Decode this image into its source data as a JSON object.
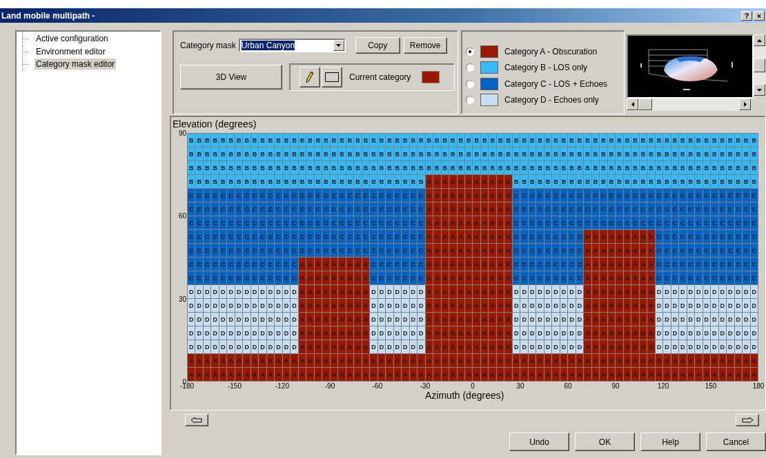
{
  "window": {
    "title": "Land mobile multipath -",
    "help_button": "?",
    "close_button": "×"
  },
  "tree": {
    "items": [
      {
        "label": "Active configuration",
        "selected": false
      },
      {
        "label": "Environment editor",
        "selected": false
      },
      {
        "label": "Category mask editor",
        "selected": true
      }
    ]
  },
  "mask": {
    "label": "Category mask",
    "value": "Urban Canyon",
    "buttons": [
      "Copy",
      "Remove"
    ]
  },
  "view_button": "3D View",
  "current_category": {
    "label": "Current category"
  },
  "categories": [
    {
      "label": "Category A - Obscuration",
      "color": "#9a1800",
      "selected": true
    },
    {
      "label": "Category B - LOS only",
      "color": "#33bbff",
      "selected": false
    },
    {
      "label": "Category C - LOS + Echoes",
      "color": "#0064c4",
      "selected": false
    },
    {
      "label": "Category D - Echoes only",
      "color": "#c6def2",
      "selected": false
    }
  ],
  "grid": {
    "title": "Elevation (degrees)",
    "xlabel": "Azimuth (degrees)",
    "y_ticks": [
      "90",
      "60",
      "30",
      "0"
    ],
    "x_ticks": [
      "-180",
      "-150",
      "-120",
      "-90",
      "-60",
      "-30",
      "0",
      "30",
      "60",
      "90",
      "120",
      "150",
      "180"
    ],
    "rows": [
      [
        "B",
        "B",
        "B",
        "B",
        "B",
        "B",
        "B",
        "B",
        "B",
        "B",
        "B",
        "B",
        "B",
        "B",
        "B",
        "B",
        "B",
        "B",
        "B",
        "B",
        "B",
        "B",
        "B",
        "B",
        "B",
        "B",
        "B",
        "B",
        "B",
        "B",
        "B",
        "B",
        "B",
        "B",
        "B",
        "B",
        "B",
        "B",
        "B",
        "B",
        "B",
        "B",
        "B",
        "B",
        "B",
        "B",
        "B",
        "B",
        "B",
        "B",
        "B",
        "B",
        "B",
        "B",
        "B",
        "B",
        "B",
        "B",
        "B",
        "B",
        "B",
        "B",
        "B",
        "B",
        "B",
        "B",
        "B",
        "B",
        "B",
        "B",
        "B",
        "B"
      ],
      [
        "B",
        "B",
        "B",
        "B",
        "B",
        "B",
        "B",
        "B",
        "B",
        "B",
        "B",
        "B",
        "B",
        "B",
        "B",
        "B",
        "B",
        "B",
        "B",
        "B",
        "B",
        "B",
        "B",
        "B",
        "B",
        "B",
        "B",
        "B",
        "B",
        "B",
        "B",
        "B",
        "B",
        "B",
        "B",
        "B",
        "B",
        "B",
        "B",
        "B",
        "B",
        "B",
        "B",
        "B",
        "B",
        "B",
        "B",
        "B",
        "B",
        "B",
        "B",
        "B",
        "B",
        "B",
        "B",
        "B",
        "B",
        "B",
        "B",
        "B",
        "B",
        "B",
        "B",
        "B",
        "B",
        "B",
        "B",
        "B",
        "B",
        "B",
        "B",
        "B"
      ],
      [
        "B",
        "B",
        "B",
        "B",
        "B",
        "B",
        "B",
        "B",
        "B",
        "B",
        "B",
        "B",
        "B",
        "B",
        "B",
        "B",
        "B",
        "B",
        "B",
        "B",
        "B",
        "B",
        "B",
        "B",
        "B",
        "B",
        "B",
        "B",
        "B",
        "B",
        "B",
        "B",
        "B",
        "B",
        "B",
        "B",
        "B",
        "B",
        "B",
        "B",
        "B",
        "B",
        "B",
        "B",
        "B",
        "B",
        "B",
        "B",
        "B",
        "B",
        "B",
        "B",
        "B",
        "B",
        "B",
        "B",
        "B",
        "B",
        "B",
        "B",
        "B",
        "B",
        "B",
        "B",
        "B",
        "B",
        "B",
        "B",
        "B",
        "B",
        "B",
        "B"
      ],
      [
        "B",
        "B",
        "B",
        "B",
        "B",
        "B",
        "B",
        "B",
        "B",
        "B",
        "B",
        "B",
        "B",
        "B",
        "B",
        "B",
        "B",
        "B",
        "B",
        "B",
        "B",
        "B",
        "B",
        "B",
        "B",
        "B",
        "B",
        "B",
        "B",
        "B",
        "A",
        "A",
        "A",
        "A",
        "A",
        "A",
        "A",
        "A",
        "A",
        "A",
        "A",
        "B",
        "B",
        "B",
        "B",
        "B",
        "B",
        "B",
        "B",
        "B",
        "B",
        "B",
        "B",
        "B",
        "B",
        "B",
        "B",
        "B",
        "B",
        "B",
        "B",
        "B",
        "B",
        "B",
        "B",
        "B",
        "B",
        "B",
        "B",
        "B",
        "B",
        "B"
      ],
      [
        "C",
        "C",
        "C",
        "C",
        "C",
        "C",
        "C",
        "C",
        "C",
        "C",
        "C",
        "C",
        "C",
        "C",
        "C",
        "C",
        "C",
        "C",
        "C",
        "C",
        "C",
        "C",
        "C",
        "C",
        "C",
        "C",
        "C",
        "C",
        "C",
        "C",
        "A",
        "A",
        "A",
        "A",
        "A",
        "A",
        "A",
        "A",
        "A",
        "A",
        "A",
        "C",
        "C",
        "C",
        "C",
        "C",
        "C",
        "C",
        "C",
        "C",
        "C",
        "C",
        "C",
        "C",
        "C",
        "C",
        "C",
        "C",
        "C",
        "C",
        "C",
        "C",
        "C",
        "C",
        "C",
        "C",
        "C",
        "C",
        "C",
        "C",
        "C",
        "C"
      ],
      [
        "C",
        "C",
        "C",
        "C",
        "C",
        "C",
        "C",
        "C",
        "C",
        "C",
        "C",
        "C",
        "C",
        "C",
        "C",
        "C",
        "C",
        "C",
        "C",
        "C",
        "C",
        "C",
        "C",
        "C",
        "C",
        "C",
        "C",
        "C",
        "C",
        "C",
        "A",
        "A",
        "A",
        "A",
        "A",
        "A",
        "A",
        "A",
        "A",
        "A",
        "A",
        "C",
        "C",
        "C",
        "C",
        "C",
        "C",
        "C",
        "C",
        "C",
        "C",
        "C",
        "C",
        "C",
        "C",
        "C",
        "C",
        "C",
        "C",
        "C",
        "C",
        "C",
        "C",
        "C",
        "C",
        "C",
        "C",
        "C",
        "C",
        "C",
        "C",
        "C"
      ],
      [
        "C",
        "C",
        "C",
        "C",
        "C",
        "C",
        "C",
        "C",
        "C",
        "C",
        "C",
        "C",
        "C",
        "C",
        "C",
        "C",
        "C",
        "C",
        "C",
        "C",
        "C",
        "C",
        "C",
        "C",
        "C",
        "C",
        "C",
        "C",
        "C",
        "C",
        "A",
        "A",
        "A",
        "A",
        "A",
        "A",
        "A",
        "A",
        "A",
        "A",
        "A",
        "C",
        "C",
        "C",
        "C",
        "C",
        "C",
        "C",
        "C",
        "C",
        "C",
        "C",
        "C",
        "C",
        "C",
        "C",
        "C",
        "C",
        "C",
        "C",
        "C",
        "C",
        "C",
        "C",
        "C",
        "C",
        "C",
        "C",
        "C",
        "C",
        "C",
        "C"
      ],
      [
        "C",
        "C",
        "C",
        "C",
        "C",
        "C",
        "C",
        "C",
        "C",
        "C",
        "C",
        "C",
        "C",
        "C",
        "C",
        "C",
        "C",
        "C",
        "C",
        "C",
        "C",
        "C",
        "C",
        "C",
        "C",
        "C",
        "C",
        "C",
        "C",
        "C",
        "A",
        "A",
        "A",
        "A",
        "A",
        "A",
        "A",
        "A",
        "A",
        "A",
        "A",
        "C",
        "C",
        "C",
        "C",
        "C",
        "C",
        "C",
        "C",
        "C",
        "A",
        "A",
        "A",
        "A",
        "A",
        "A",
        "A",
        "A",
        "A",
        "C",
        "C",
        "C",
        "C",
        "C",
        "C",
        "C",
        "C",
        "C",
        "C",
        "C",
        "C",
        "C"
      ],
      [
        "C",
        "C",
        "C",
        "C",
        "C",
        "C",
        "C",
        "C",
        "C",
        "C",
        "C",
        "C",
        "C",
        "C",
        "C",
        "C",
        "C",
        "C",
        "C",
        "C",
        "C",
        "C",
        "C",
        "C",
        "C",
        "C",
        "C",
        "C",
        "C",
        "C",
        "A",
        "A",
        "A",
        "A",
        "A",
        "A",
        "A",
        "A",
        "A",
        "A",
        "A",
        "C",
        "C",
        "C",
        "C",
        "C",
        "C",
        "C",
        "C",
        "C",
        "A",
        "A",
        "A",
        "A",
        "A",
        "A",
        "A",
        "A",
        "A",
        "C",
        "C",
        "C",
        "C",
        "C",
        "C",
        "C",
        "C",
        "C",
        "C",
        "C",
        "C",
        "C"
      ],
      [
        "C",
        "C",
        "C",
        "C",
        "C",
        "C",
        "C",
        "C",
        "C",
        "C",
        "C",
        "C",
        "C",
        "C",
        "A",
        "A",
        "A",
        "A",
        "A",
        "A",
        "A",
        "A",
        "A",
        "C",
        "C",
        "C",
        "C",
        "C",
        "C",
        "C",
        "A",
        "A",
        "A",
        "A",
        "A",
        "A",
        "A",
        "A",
        "A",
        "A",
        "A",
        "C",
        "C",
        "C",
        "C",
        "C",
        "C",
        "C",
        "C",
        "C",
        "A",
        "A",
        "A",
        "A",
        "A",
        "A",
        "A",
        "A",
        "A",
        "C",
        "C",
        "C",
        "C",
        "C",
        "C",
        "C",
        "C",
        "C",
        "C",
        "C",
        "C",
        "C"
      ],
      [
        "C",
        "C",
        "C",
        "C",
        "C",
        "C",
        "C",
        "C",
        "C",
        "C",
        "C",
        "C",
        "C",
        "C",
        "A",
        "A",
        "A",
        "A",
        "A",
        "A",
        "A",
        "A",
        "A",
        "C",
        "C",
        "C",
        "C",
        "C",
        "C",
        "C",
        "A",
        "A",
        "A",
        "A",
        "A",
        "A",
        "A",
        "A",
        "A",
        "A",
        "A",
        "C",
        "C",
        "C",
        "C",
        "C",
        "C",
        "C",
        "C",
        "C",
        "A",
        "A",
        "A",
        "A",
        "A",
        "A",
        "A",
        "A",
        "A",
        "C",
        "C",
        "C",
        "C",
        "C",
        "C",
        "C",
        "C",
        "C",
        "C",
        "C",
        "C",
        "C"
      ],
      [
        "D",
        "D",
        "D",
        "D",
        "D",
        "D",
        "D",
        "D",
        "D",
        "D",
        "D",
        "D",
        "D",
        "D",
        "A",
        "A",
        "A",
        "A",
        "A",
        "A",
        "A",
        "A",
        "A",
        "D",
        "D",
        "D",
        "D",
        "D",
        "D",
        "D",
        "A",
        "A",
        "A",
        "A",
        "A",
        "A",
        "A",
        "A",
        "A",
        "A",
        "A",
        "D",
        "D",
        "D",
        "D",
        "D",
        "D",
        "D",
        "D",
        "D",
        "A",
        "A",
        "A",
        "A",
        "A",
        "A",
        "A",
        "A",
        "A",
        "D",
        "D",
        "D",
        "D",
        "D",
        "D",
        "D",
        "D",
        "D",
        "D",
        "D",
        "D",
        "D"
      ],
      [
        "D",
        "D",
        "D",
        "D",
        "D",
        "D",
        "D",
        "D",
        "D",
        "D",
        "D",
        "D",
        "D",
        "D",
        "A",
        "A",
        "A",
        "A",
        "A",
        "A",
        "A",
        "A",
        "A",
        "D",
        "D",
        "D",
        "D",
        "D",
        "D",
        "D",
        "A",
        "A",
        "A",
        "A",
        "A",
        "A",
        "A",
        "A",
        "A",
        "A",
        "A",
        "D",
        "D",
        "D",
        "D",
        "D",
        "D",
        "D",
        "D",
        "D",
        "A",
        "A",
        "A",
        "A",
        "A",
        "A",
        "A",
        "A",
        "A",
        "D",
        "D",
        "D",
        "D",
        "D",
        "D",
        "D",
        "D",
        "D",
        "D",
        "D",
        "D",
        "D"
      ],
      [
        "D",
        "D",
        "D",
        "D",
        "D",
        "D",
        "D",
        "D",
        "D",
        "D",
        "D",
        "D",
        "D",
        "D",
        "A",
        "A",
        "A",
        "A",
        "A",
        "A",
        "A",
        "A",
        "A",
        "D",
        "D",
        "D",
        "D",
        "D",
        "D",
        "D",
        "A",
        "A",
        "A",
        "A",
        "A",
        "A",
        "A",
        "A",
        "A",
        "A",
        "A",
        "D",
        "D",
        "D",
        "D",
        "D",
        "D",
        "D",
        "D",
        "D",
        "A",
        "A",
        "A",
        "A",
        "A",
        "A",
        "A",
        "A",
        "A",
        "D",
        "D",
        "D",
        "D",
        "D",
        "D",
        "D",
        "D",
        "D",
        "D",
        "D",
        "D",
        "D"
      ],
      [
        "D",
        "D",
        "D",
        "D",
        "D",
        "D",
        "D",
        "D",
        "D",
        "D",
        "D",
        "D",
        "D",
        "D",
        "A",
        "A",
        "A",
        "A",
        "A",
        "A",
        "A",
        "A",
        "A",
        "D",
        "D",
        "D",
        "D",
        "D",
        "D",
        "D",
        "A",
        "A",
        "A",
        "A",
        "A",
        "A",
        "A",
        "A",
        "A",
        "A",
        "A",
        "D",
        "D",
        "D",
        "D",
        "D",
        "D",
        "D",
        "D",
        "D",
        "A",
        "A",
        "A",
        "A",
        "A",
        "A",
        "A",
        "A",
        "A",
        "D",
        "D",
        "D",
        "D",
        "D",
        "D",
        "D",
        "D",
        "D",
        "D",
        "D",
        "D",
        "D"
      ],
      [
        "D",
        "D",
        "D",
        "D",
        "D",
        "D",
        "D",
        "D",
        "D",
        "D",
        "D",
        "D",
        "D",
        "D",
        "A",
        "A",
        "A",
        "A",
        "A",
        "A",
        "A",
        "A",
        "A",
        "D",
        "D",
        "D",
        "D",
        "D",
        "D",
        "D",
        "A",
        "A",
        "A",
        "A",
        "A",
        "A",
        "A",
        "A",
        "A",
        "A",
        "A",
        "D",
        "D",
        "D",
        "D",
        "D",
        "D",
        "D",
        "D",
        "D",
        "A",
        "A",
        "A",
        "A",
        "A",
        "A",
        "A",
        "A",
        "A",
        "D",
        "D",
        "D",
        "D",
        "D",
        "D",
        "D",
        "D",
        "D",
        "D",
        "D",
        "D",
        "D"
      ],
      [
        "A",
        "A",
        "A",
        "A",
        "A",
        "A",
        "A",
        "A",
        "A",
        "A",
        "A",
        "A",
        "A",
        "A",
        "A",
        "A",
        "A",
        "A",
        "A",
        "A",
        "A",
        "A",
        "A",
        "A",
        "A",
        "A",
        "A",
        "A",
        "A",
        "A",
        "A",
        "A",
        "A",
        "A",
        "A",
        "A",
        "A",
        "A",
        "A",
        "A",
        "A",
        "A",
        "A",
        "A",
        "A",
        "A",
        "A",
        "A",
        "A",
        "A",
        "A",
        "A",
        "A",
        "A",
        "A",
        "A",
        "A",
        "A",
        "A",
        "A",
        "A",
        "A",
        "A",
        "A",
        "A",
        "A",
        "A",
        "A",
        "A",
        "A",
        "A",
        "A"
      ],
      [
        "A",
        "A",
        "A",
        "A",
        "A",
        "A",
        "A",
        "A",
        "A",
        "A",
        "A",
        "A",
        "A",
        "A",
        "A",
        "A",
        "A",
        "A",
        "A",
        "A",
        "A",
        "A",
        "A",
        "A",
        "A",
        "A",
        "A",
        "A",
        "A",
        "A",
        "A",
        "A",
        "A",
        "A",
        "A",
        "A",
        "A",
        "A",
        "A",
        "A",
        "A",
        "A",
        "A",
        "A",
        "A",
        "A",
        "A",
        "A",
        "A",
        "A",
        "A",
        "A",
        "A",
        "A",
        "A",
        "A",
        "A",
        "A",
        "A",
        "A",
        "A",
        "A",
        "A",
        "A",
        "A",
        "A",
        "A",
        "A",
        "A",
        "A",
        "A",
        "A"
      ]
    ]
  },
  "buttons": [
    "Undo",
    "OK",
    "Help",
    "Cancel"
  ]
}
